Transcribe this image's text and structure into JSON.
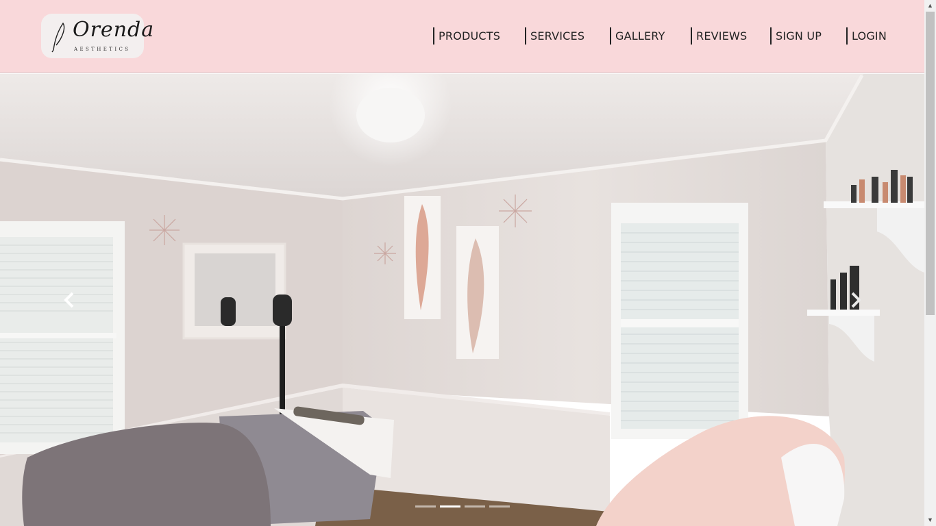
{
  "brand": {
    "name": "Orenda",
    "tagline": "AESTHETICS"
  },
  "nav": [
    {
      "label": "PRODUCTS"
    },
    {
      "label": "SERVICES"
    },
    {
      "label": "GALLERY"
    },
    {
      "label": "REVIEWS"
    },
    {
      "label": "SIGN UP"
    },
    {
      "label": "LOGIN"
    }
  ],
  "carousel": {
    "slide_count": 4,
    "active_index": 1,
    "image": "treatment-room-photo",
    "prev_icon": "chevron-left-icon",
    "next_icon": "chevron-right-icon"
  },
  "colors": {
    "header_bg": "#f9d8da",
    "text": "#222222"
  }
}
